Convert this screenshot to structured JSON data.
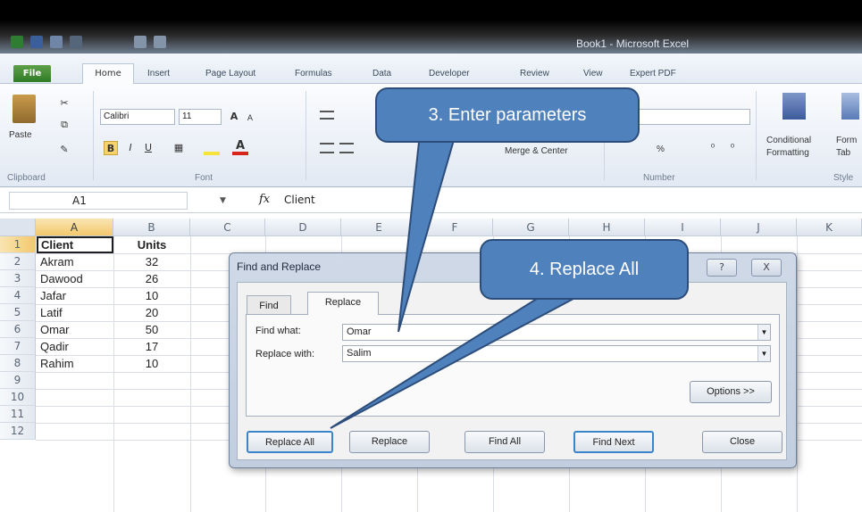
{
  "window": {
    "title": "Book1 - Microsoft Excel"
  },
  "ribbon_tabs": [
    {
      "label": "File"
    },
    {
      "label": "Home"
    },
    {
      "label": "Insert"
    },
    {
      "label": "Page Layout"
    },
    {
      "label": "Formulas"
    },
    {
      "label": "Data"
    },
    {
      "label": "Developer"
    },
    {
      "label": "Review"
    },
    {
      "label": "View"
    },
    {
      "label": "Expert PDF"
    }
  ],
  "ribbon": {
    "paste_label": "Paste",
    "font_name": "Calibri",
    "font_size": "11",
    "bold": "B",
    "italic": "I",
    "underline": "U",
    "merge_center": "Merge & Center",
    "number_format": "%",
    "conditional_formatting_1": "Conditional",
    "conditional_formatting_2": "Formatting",
    "format_as_table_1": "Form",
    "format_as_table_2": "Tab",
    "groups": {
      "clipboard": "Clipboard",
      "font": "Font",
      "number": "Number",
      "styles": "Style"
    }
  },
  "formula_bar": {
    "name_box": "A1",
    "fx": "fx",
    "value": "Client"
  },
  "grid": {
    "columns": [
      "A",
      "B",
      "C",
      "D",
      "E",
      "F",
      "G",
      "H",
      "I",
      "J",
      "K"
    ],
    "rows": [
      "1",
      "2",
      "3",
      "4",
      "5",
      "6",
      "7",
      "8",
      "9",
      "10",
      "11",
      "12"
    ],
    "header_row": [
      "Client",
      "Units"
    ],
    "data": [
      [
        "Akram",
        "32"
      ],
      [
        "Dawood",
        "26"
      ],
      [
        "Jafar",
        "10"
      ],
      [
        "Latif",
        "20"
      ],
      [
        "Omar",
        "50"
      ],
      [
        "Qadir",
        "17"
      ],
      [
        "Rahim",
        "10"
      ]
    ]
  },
  "dialog": {
    "title": "Find and Replace",
    "help": "?",
    "close_x": "X",
    "tabs": [
      {
        "label": "Find"
      },
      {
        "label": "Replace"
      }
    ],
    "find_what_label": "Find what:",
    "find_what_value": "Omar",
    "replace_with_label": "Replace with:",
    "replace_with_value": "Salim",
    "options_button": "Options >>",
    "buttons": {
      "replace_all": "Replace All",
      "replace": "Replace",
      "find_all": "Find All",
      "find_next": "Find Next",
      "close": "Close"
    }
  },
  "callouts": {
    "step3": "3. Enter parameters",
    "step4": "4. Replace All"
  }
}
